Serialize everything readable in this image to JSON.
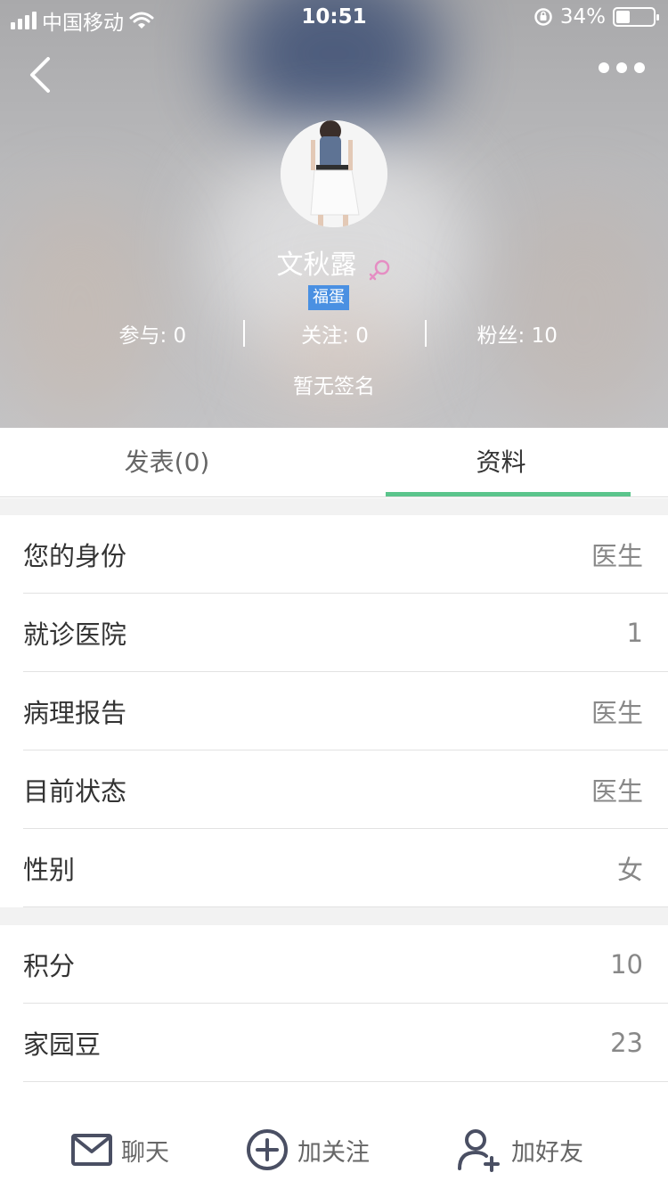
{
  "status_bar": {
    "carrier": "中国移动",
    "time": "10:51",
    "battery": "34%"
  },
  "profile": {
    "name": "文秋露",
    "gender_icon": "female-icon",
    "badge": "福蛋",
    "stats": [
      {
        "label": "参与: 0"
      },
      {
        "label": "关注: 0"
      },
      {
        "label": "粉丝: 10"
      }
    ],
    "signature": "暂无签名"
  },
  "tabs": [
    {
      "label": "发表(0)",
      "active": false
    },
    {
      "label": "资料",
      "active": true
    }
  ],
  "info_group_1": [
    {
      "label": "您的身份",
      "value": "医生"
    },
    {
      "label": "就诊医院",
      "value": "1"
    },
    {
      "label": "病理报告",
      "value": "医生"
    },
    {
      "label": "目前状态",
      "value": "医生"
    },
    {
      "label": "性别",
      "value": "女"
    }
  ],
  "info_group_2": [
    {
      "label": "积分",
      "value": "10"
    },
    {
      "label": "家园豆",
      "value": "23"
    }
  ],
  "actions": {
    "chat": "聊天",
    "follow": "加关注",
    "add_friend": "加好友"
  },
  "colors": {
    "accent": "#5bc58c",
    "badge": "#4a90e2",
    "gender": "#e58ec3"
  }
}
